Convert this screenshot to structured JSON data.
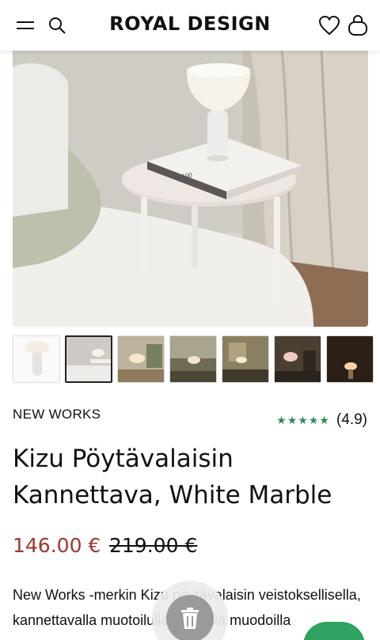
{
  "header": {
    "logo": "ROYAL DESIGN",
    "icons": [
      "menu-icon",
      "search-icon",
      "heart-icon",
      "bag-icon"
    ]
  },
  "gallery": {
    "thumbnail_count": 7,
    "selected_index": 1
  },
  "product": {
    "brand": "NEW WORKS",
    "stars": "★★★★★",
    "rating": "(4.9)",
    "title": "Kizu Pöytävalaisin Kannettava, White Marble",
    "price": "146.00 €",
    "old_price": "219.00 €",
    "description": "New Works -merkin Kizu pöytävalaisin veistoksellisella, kannettavalla muotoilulla rohkeilla muodoilla"
  },
  "colors": {
    "price": "#a1352d",
    "stars": "#2f8a57",
    "fab_green": "#2fa35f"
  }
}
